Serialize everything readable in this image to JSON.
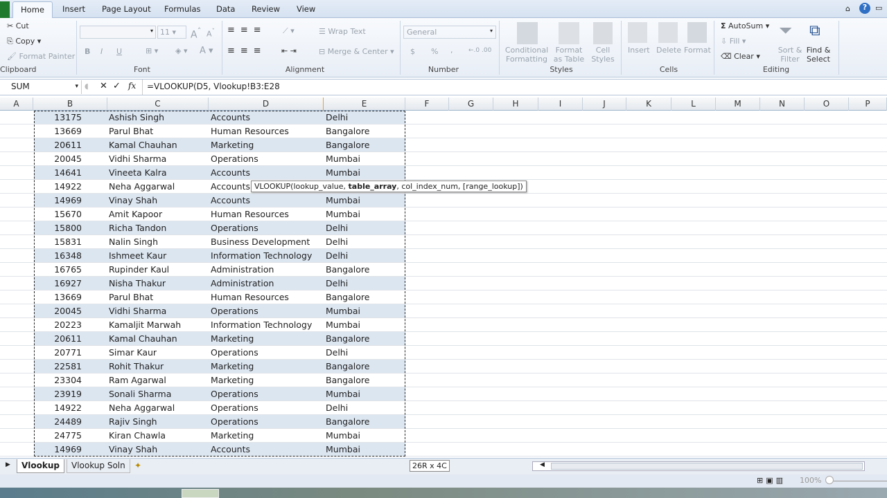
{
  "ribbon_tabs": [
    "Home",
    "Insert",
    "Page Layout",
    "Formulas",
    "Data",
    "Review",
    "View"
  ],
  "clipboard": {
    "cut": "Cut",
    "copy": "Copy",
    "format_painter": "Format Painter",
    "group": "Clipboard"
  },
  "font": {
    "name": "",
    "size": "11",
    "group": "Font",
    "bold": "B",
    "italic": "I",
    "underline": "U"
  },
  "alignment": {
    "wrap_text": "Wrap Text",
    "merge_center": "Merge & Center",
    "group": "Alignment"
  },
  "number": {
    "format": "General",
    "currency": "$",
    "percent": "%",
    "comma": ",",
    "group": "Number"
  },
  "styles": {
    "conditional": "Conditional Formatting",
    "format_table": "Format as Table",
    "cell_styles": "Cell Styles",
    "group": "Styles"
  },
  "cells": {
    "insert": "Insert",
    "delete": "Delete",
    "format": "Format",
    "group": "Cells"
  },
  "editing": {
    "autosum": "AutoSum",
    "fill": "Fill",
    "clear": "Clear",
    "sort": "Sort & Filter",
    "find": "Find & Select",
    "group": "Editing"
  },
  "formula_bar": {
    "name_box": "SUM",
    "formula": "=VLOOKUP(D5, Vlookup!B3:E28"
  },
  "columns": [
    "A",
    "B",
    "C",
    "D",
    "E",
    "F",
    "G",
    "H",
    "I",
    "J",
    "K",
    "L",
    "M",
    "N",
    "O",
    "P"
  ],
  "rows": [
    [
      "13175",
      "Ashish Singh",
      "Accounts",
      "Delhi"
    ],
    [
      "13669",
      "Parul Bhat",
      "Human Resources",
      "Bangalore"
    ],
    [
      "20611",
      "Kamal Chauhan",
      "Marketing",
      "Bangalore"
    ],
    [
      "20045",
      "Vidhi Sharma",
      "Operations",
      "Mumbai"
    ],
    [
      "14641",
      "Vineeta Kalra",
      "Accounts",
      "Mumbai"
    ],
    [
      "14922",
      "Neha Aggarwal",
      "Accounts",
      ""
    ],
    [
      "14969",
      "Vinay Shah",
      "Accounts",
      "Mumbai"
    ],
    [
      "15670",
      "Amit Kapoor",
      "Human Resources",
      "Mumbai"
    ],
    [
      "15800",
      "Richa Tandon",
      "Operations",
      "Delhi"
    ],
    [
      "15831",
      "Nalin Singh",
      "Business Development",
      "Delhi"
    ],
    [
      "16348",
      "Ishmeet Kaur",
      "Information Technology",
      "Delhi"
    ],
    [
      "16765",
      "Rupinder Kaul",
      "Administration",
      "Bangalore"
    ],
    [
      "16927",
      "Nisha Thakur",
      "Administration",
      "Delhi"
    ],
    [
      "13669",
      "Parul Bhat",
      "Human Resources",
      "Bangalore"
    ],
    [
      "20045",
      "Vidhi Sharma",
      "Operations",
      "Mumbai"
    ],
    [
      "20223",
      "Kamaljit Marwah",
      "Information Technology",
      "Mumbai"
    ],
    [
      "20611",
      "Kamal Chauhan",
      "Marketing",
      "Bangalore"
    ],
    [
      "20771",
      "Simar Kaur",
      "Operations",
      "Delhi"
    ],
    [
      "22581",
      "Rohit Thakur",
      "Marketing",
      "Bangalore"
    ],
    [
      "23304",
      "Ram Agarwal",
      "Marketing",
      "Bangalore"
    ],
    [
      "23919",
      "Sonali Sharma",
      "Operations",
      "Mumbai"
    ],
    [
      "14922",
      "Neha Aggarwal",
      "Operations",
      "Delhi"
    ],
    [
      "24489",
      "Rajiv Singh",
      "Operations",
      "Bangalore"
    ],
    [
      "24775",
      "Kiran Chawla",
      "Marketing",
      "Mumbai"
    ],
    [
      "14969",
      "Vinay Shah",
      "Accounts",
      "Mumbai"
    ]
  ],
  "tooltip": {
    "pre": "VLOOKUP(lookup_value, ",
    "bold": "table_array",
    "post": ", col_index_num, [range_lookup])"
  },
  "sheets": [
    "Vlookup",
    "Vlookup Soln"
  ],
  "selection_size": "26R x 4C",
  "zoom": "100%",
  "colors": {
    "band": "#dce6f1",
    "ribbon": "#e8eef6"
  }
}
